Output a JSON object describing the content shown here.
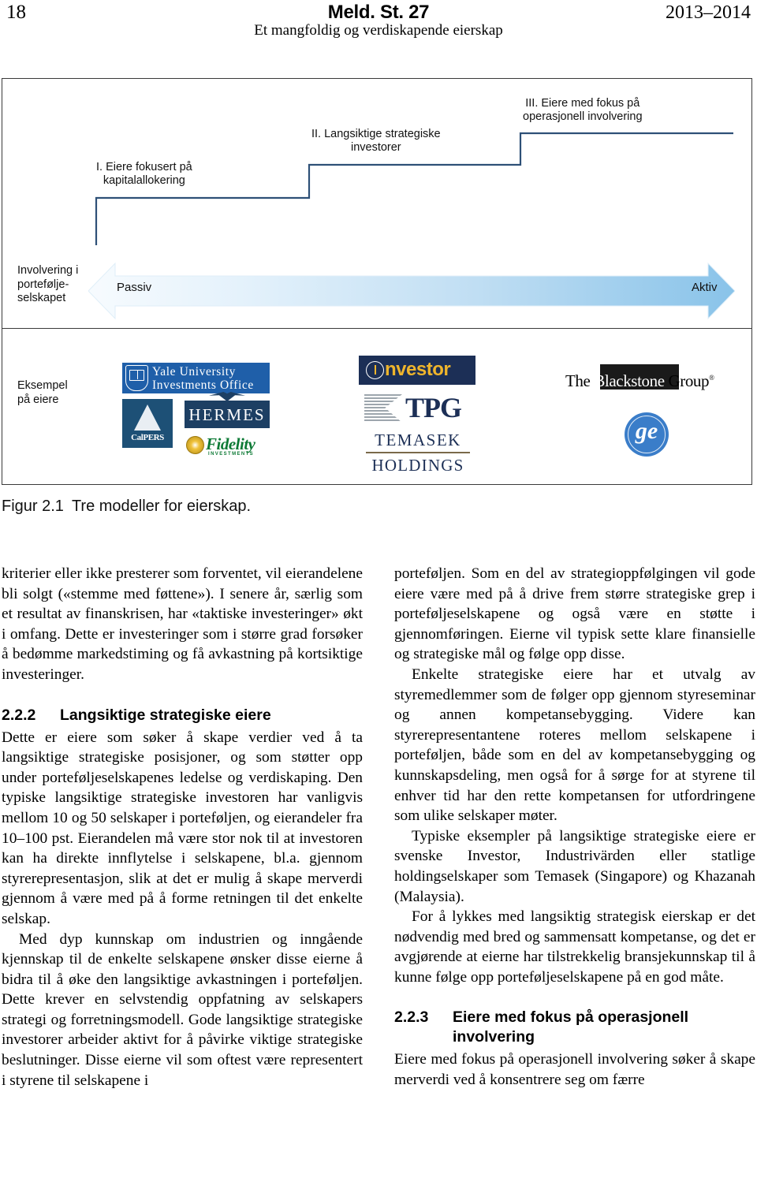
{
  "runhead": {
    "folio": "18",
    "doc_title": "Meld. St. 27",
    "years": "2013–2014",
    "subtitle": "Et mangfoldig og verdiskapende eierskap"
  },
  "figure": {
    "caption_number": "Figur 2.1",
    "caption_text": "Tre modeller for eierskap.",
    "steps": [
      {
        "label_line1": "I. Eiere fokusert på",
        "label_line2": "kapitalallokering"
      },
      {
        "label_line1": "II. Langsiktige strategiske",
        "label_line2": "investorer"
      },
      {
        "label_line1": "III. Eiere med fokus på",
        "label_line2": "operasjonell involvering"
      }
    ],
    "axis": {
      "row_label_line1": "Involvering i",
      "row_label_line2": "portefølje-",
      "row_label_line3": "selskapet",
      "left_end": "Passiv",
      "right_end": "Aktiv",
      "arrow_color_start": "#f4fafe",
      "arrow_color_end": "#8cc5ea"
    },
    "examples": {
      "row_label_line1": "Eksempel",
      "row_label_line2": "på eiere",
      "column1": [
        {
          "name": "Yale University Investments Office",
          "line1": "Yale University",
          "line2": "Investments Office"
        },
        {
          "name": "CalPERS",
          "line1": "CalPERS"
        },
        {
          "name": "HERMES",
          "line1": "HERMES"
        },
        {
          "name": "Fidelity Investments",
          "line1": "Fidelity",
          "line2": "INVESTMENTS"
        }
      ],
      "column2": [
        {
          "name": "Investor",
          "line1": "nvestor"
        },
        {
          "name": "TPG",
          "line1": "TPG"
        },
        {
          "name": "Temasek Holdings",
          "line1": "TEMASEK",
          "line2": "HOLDINGS"
        }
      ],
      "column3": [
        {
          "name": "The Blackstone Group",
          "pre": "The ",
          "mid": "Blackstone",
          "post": " Group",
          "reg": "®"
        },
        {
          "name": "GE",
          "line1": "ge"
        }
      ]
    }
  },
  "body": {
    "left_column": {
      "para1": "kriterier eller ikke presterer som forventet, vil eierandelene bli solgt («stemme med føttene»). I senere år, særlig som et resultat av finanskrisen, har «taktiske investeringer» økt i omfang. Dette er investeringer som i større grad forsøker å bedømme markedstiming og få avkastning på kortsiktige investeringer.",
      "heading_number": "2.2.2",
      "heading_title": "Langsiktige strategiske eiere",
      "para2": "Dette er eiere som søker å skape verdier ved å ta langsiktige strategiske posisjoner, og som støtter opp under porteføljeselskapenes ledelse og verdiskaping. Den typiske langsiktige strategiske investoren har vanligvis mellom 10 og 50 selskaper i porteføljen, og eierandeler fra 10–100 pst. Eierandelen må være stor nok til at investoren kan ha direkte innflytelse i selskapene, bl.a. gjennom styrerepresentasjon, slik at det er mulig å skape merverdi gjennom å være med på å forme retningen til det enkelte selskap.",
      "para3": "Med dyp kunnskap om industrien og inngående kjennskap til de enkelte selskapene ønsker disse eierne å bidra til å øke den langsiktige avkastningen i porteføljen. Dette krever en selvstendig oppfatning av selskapers strategi og forretningsmodell. Gode langsiktige strategiske investorer arbeider aktivt for å påvirke viktige strategiske beslutninger. Disse eierne vil som oftest være representert i styrene til selskapene i"
    },
    "right_column": {
      "para1": "porteføljen. Som en del av strategioppfølgingen vil gode eiere være med på å drive frem større strategiske grep i porteføljeselskapene og også være en støtte i gjennomføringen. Eierne vil typisk sette klare finansielle og strategiske mål og følge opp disse.",
      "para2": "Enkelte strategiske eiere har et utvalg av styremedlemmer som de følger opp gjennom styreseminar og annen kompetansebygging. Videre kan styrerepresentantene roteres mellom selskapene i porteføljen, både som en del av kompetansebygging og kunnskapsdeling, men også for å sørge for at styrene til enhver tid har den rette kompetansen for utfordringene som ulike selskaper møter.",
      "para3": "Typiske eksempler på langsiktige strategiske eiere er svenske Investor, Industrivärden eller statlige holdingselskaper som Temasek (Singapore) og Khazanah (Malaysia).",
      "para4": "For å lykkes med langsiktig strategisk eierskap er det nødvendig med bred og sammensatt kompetanse, og det er avgjørende at eierne har tilstrekkelig bransjekunnskap til å kunne følge opp porteføljeselskapene på en god måte.",
      "heading_number": "2.2.3",
      "heading_title_line1": "Eiere med fokus på operasjonell",
      "heading_title_line2": "involvering",
      "para5": "Eiere med fokus på operasjonell involvering søker å skape merverdi ved å konsentrere seg om færre"
    }
  }
}
